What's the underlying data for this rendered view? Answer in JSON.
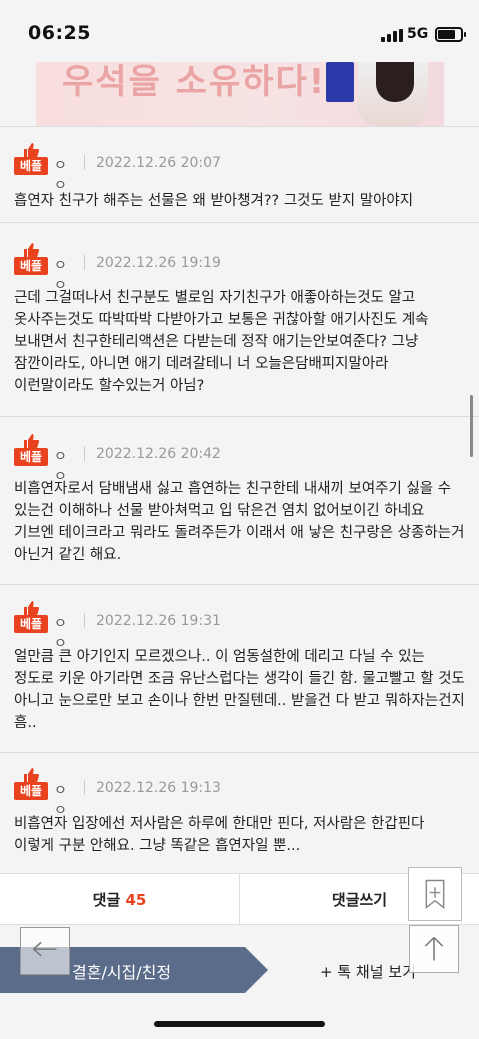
{
  "status_bar": {
    "time": "06:25",
    "network": "5G"
  },
  "banner": {
    "text": "우석을 소유하다!"
  },
  "comments": [
    {
      "badge": "베플",
      "author": "ㅇㅇ",
      "date": "2022.12.26 20:07",
      "text": "흡연자 친구가 해주는 선물은 왜 받아챙겨?? 그것도 받지 말아야지"
    },
    {
      "badge": "베플",
      "author": "ㅇㅇ",
      "date": "2022.12.26 19:19",
      "text": "근데 그걸떠나서 친구분도 별로임 자기친구가 애좋아하는것도 알고 옷사주는것도 따박따박 다받아가고 보통은 귀찮아할 애기사진도 계속 보내면서 친구한테리액션은 다받는데 정작 애기는안보여준다? 그냥 잠깐이라도, 아니면 애기 데려갈테니 너 오늘은담배피지말아라 이런말이라도 할수있는거 아님?"
    },
    {
      "badge": "베플",
      "author": "ㅇㅇ",
      "date": "2022.12.26 20:42",
      "text": "비흡연자로서 담배냄새 싫고 흡연하는 친구한테 내새끼 보여주기 싫을 수 있는건 이해하나 선물 받아쳐먹고 입 닦은건 염치 없어보이긴 하네요 기브엔 테이크라고 뭐라도 돌려주든가 이래서 애 낳은 친구랑은 상종하는거 아닌거 같긴 해요."
    },
    {
      "badge": "베플",
      "author": "ㅇㅇ",
      "date": "2022.12.26 19:31",
      "text": "얼만큼 큰 아기인지 모르겠으나.. 이 엄동설한에 데리고 다닐 수 있는 정도로 키운 아기라면 조금 유난스럽다는 생각이 들긴 함. 물고빨고 할 것도 아니고 눈으로만 보고 손이나 한번 만질텐데.. 받을건 다 받고 뭐하자는건지 흠.."
    },
    {
      "badge": "베플",
      "author": "ㅇㅇ",
      "date": "2022.12.26 19:13",
      "text": "비흡연자 입장에선 저사람은 하루에 한대만 핀다, 저사람은 한갑핀다 이렇게 구분 안해요. 그냥 똑같은 흡연자일 뿐..."
    }
  ],
  "action_bar": {
    "reply_label": "댓글",
    "reply_count": "45",
    "write_label": "댓글쓰기"
  },
  "nav": {
    "channel": "결혼/시집/친정",
    "see_channel": "+ 톡 채널 보기"
  },
  "colors": {
    "accent": "#e8421f",
    "channel_tag": "#5b6b8a"
  },
  "icons": [
    "thumbs-up-icon",
    "bookmark-plus-icon",
    "back-arrow-icon",
    "up-arrow-icon"
  ]
}
